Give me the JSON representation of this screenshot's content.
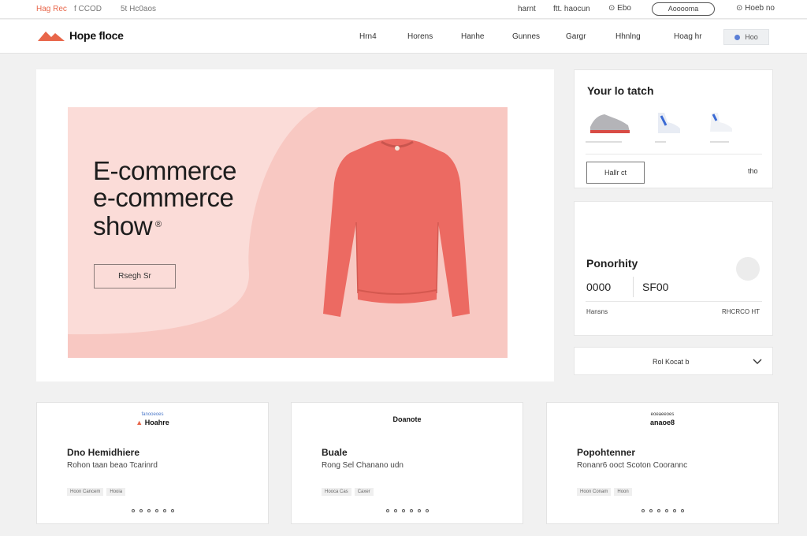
{
  "topbar": {
    "promo": "Hag Rec",
    "promo2": "f CCOD",
    "promo3": "5t Hc0aos",
    "links": [
      "harnt",
      "ftt. haocun"
    ],
    "language": "Ebo",
    "pill_label": "Aooooma",
    "login": "Hoeb no"
  },
  "nav": {
    "logo_text": "Hope floce",
    "menu": [
      "Hrn4",
      "Horens",
      "Hanhe",
      "Gunnes",
      "Gargr",
      "Hhnlng",
      "Hoag hr"
    ],
    "search_label": "Hoo"
  },
  "hero": {
    "title_line1": "E-commerce",
    "title_line2": "e-commerce",
    "title_line3": "show",
    "title_mark": "®",
    "button_label": "Rsegh Sr"
  },
  "watch": {
    "title": "Your lo tatch",
    "button_label": "Hallr ct",
    "side_text": "tho"
  },
  "priority": {
    "title": "Ponorhity",
    "value_a": "0000",
    "value_b": "SF00",
    "foot_left": "Hansns",
    "foot_right": "RHCRCO HT"
  },
  "dropdown": {
    "label": "Rol Kocat b"
  },
  "products": [
    {
      "brand_top": "fanooeoes",
      "brand": "Hoahre",
      "name": "Dno Hemidhiere",
      "desc": "Rohon taan beao Tcarinrd",
      "tags": [
        "Hoon Cancem",
        "Hooia"
      ]
    },
    {
      "brand_top": "",
      "brand": "Doanote",
      "name": "Buale",
      "desc": "Rong Sel Chanano udn",
      "tags": [
        "Hooca Cas",
        "Caxer"
      ]
    },
    {
      "brand_top": "eoeaeeoes",
      "brand": "anaoe8",
      "name": "Popohtenner",
      "desc": "Ronanr6 ooct Scoton Coorannc",
      "tags": [
        "Hoon Conam",
        "Hoon"
      ]
    }
  ],
  "colors": {
    "accent": "#e8664a",
    "hero_bg": "#f8c8c2",
    "sweater": "#ec6a62"
  }
}
